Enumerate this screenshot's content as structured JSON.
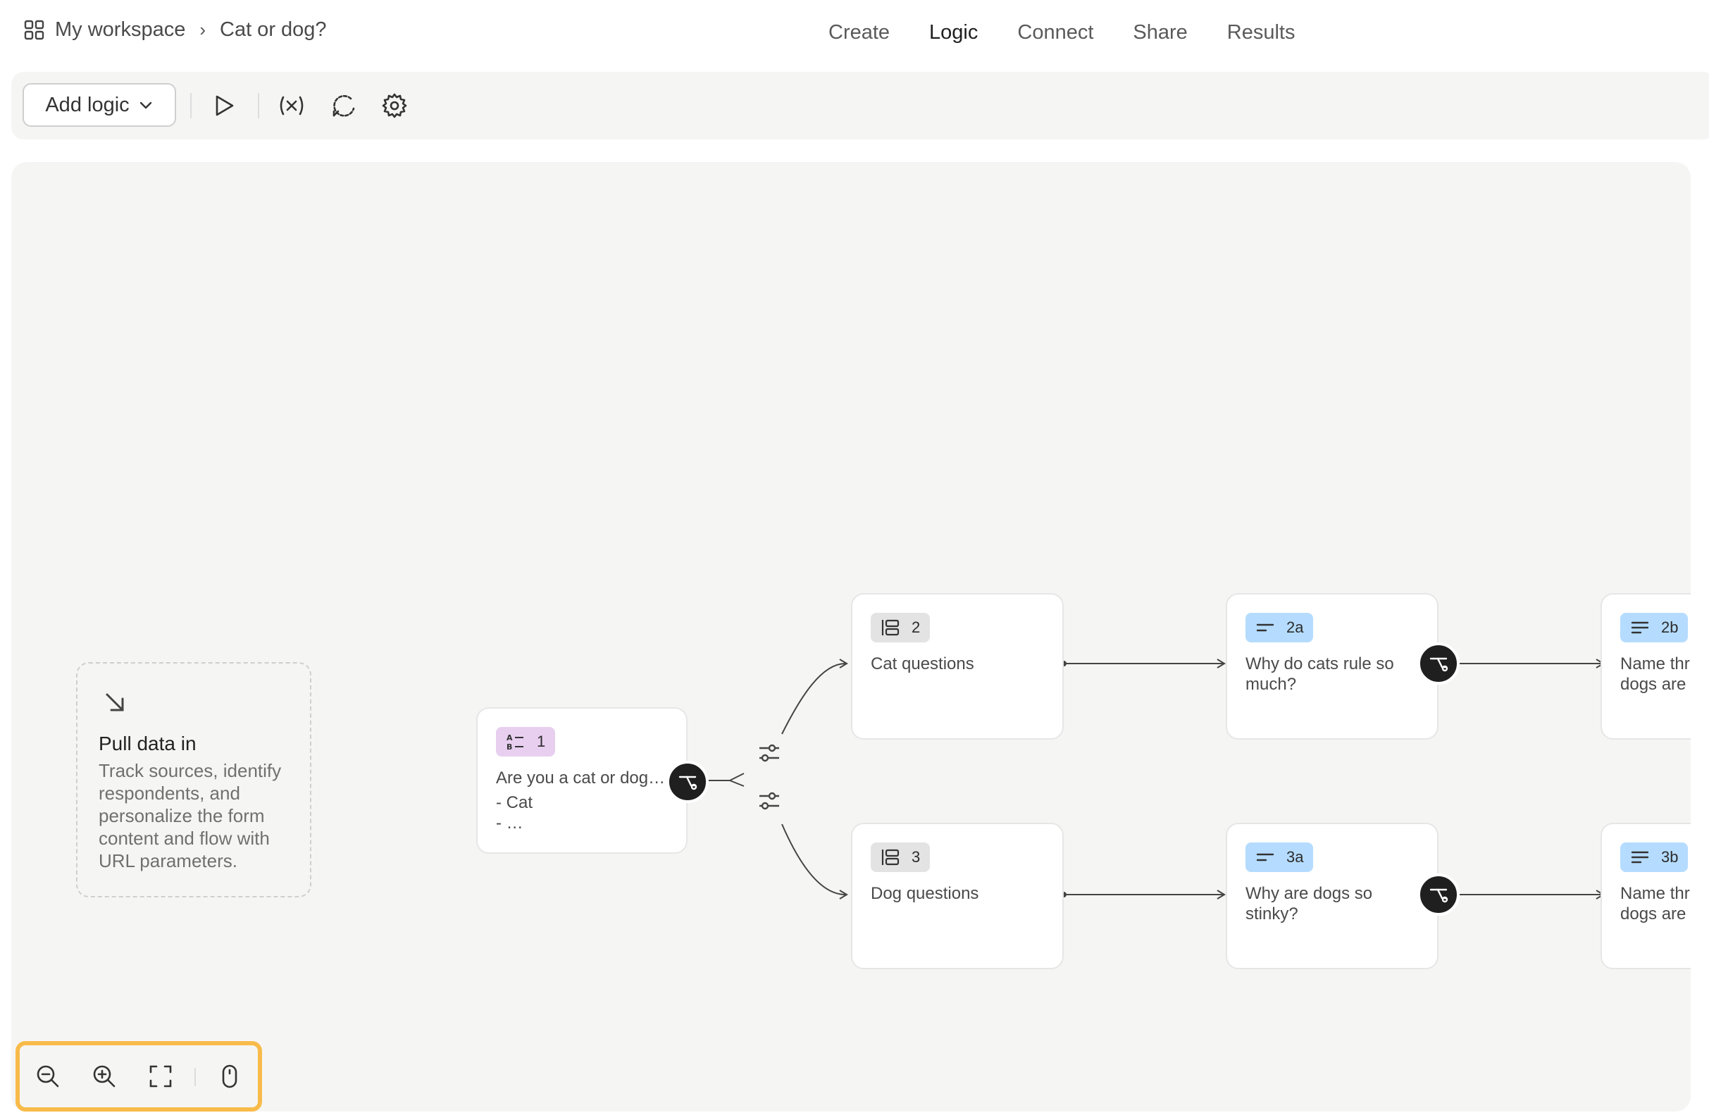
{
  "breadcrumb": {
    "workspace": "My workspace",
    "separator": "›",
    "form": "Cat or dog?"
  },
  "nav": {
    "tabs": [
      "Create",
      "Logic",
      "Connect",
      "Share",
      "Results"
    ],
    "active": "Logic"
  },
  "toolbar": {
    "add_logic_label": "Add logic"
  },
  "pull_data": {
    "title": "Pull data in",
    "description": "Track sources, identify respondents, and personalize the form content and flow with URL parameters."
  },
  "nodes": {
    "q1": {
      "number": "1",
      "line1": "Are you a cat or dog…",
      "line2": "- Cat",
      "line3": "- …"
    },
    "g2": {
      "number": "2",
      "text": "Cat questions"
    },
    "g3": {
      "number": "3",
      "text": "Dog questions"
    },
    "q2a": {
      "number": "2a",
      "line1": "Why do cats rule so",
      "line2": "much?"
    },
    "q3a": {
      "number": "3a",
      "line1": "Why are dogs so",
      "line2": "stinky?"
    },
    "q2b": {
      "number": "2b",
      "line1": "Name thr",
      "line2": "dogs are"
    },
    "q3b": {
      "number": "3b",
      "line1": "Name thr",
      "line2": "dogs are"
    }
  },
  "colors": {
    "highlight_border": "#f8bb4a",
    "badge_choice": "#e8cff0",
    "badge_group": "#e3e3e3",
    "badge_text": "#b5dcff",
    "branch_dot": "#1f1f1f"
  }
}
